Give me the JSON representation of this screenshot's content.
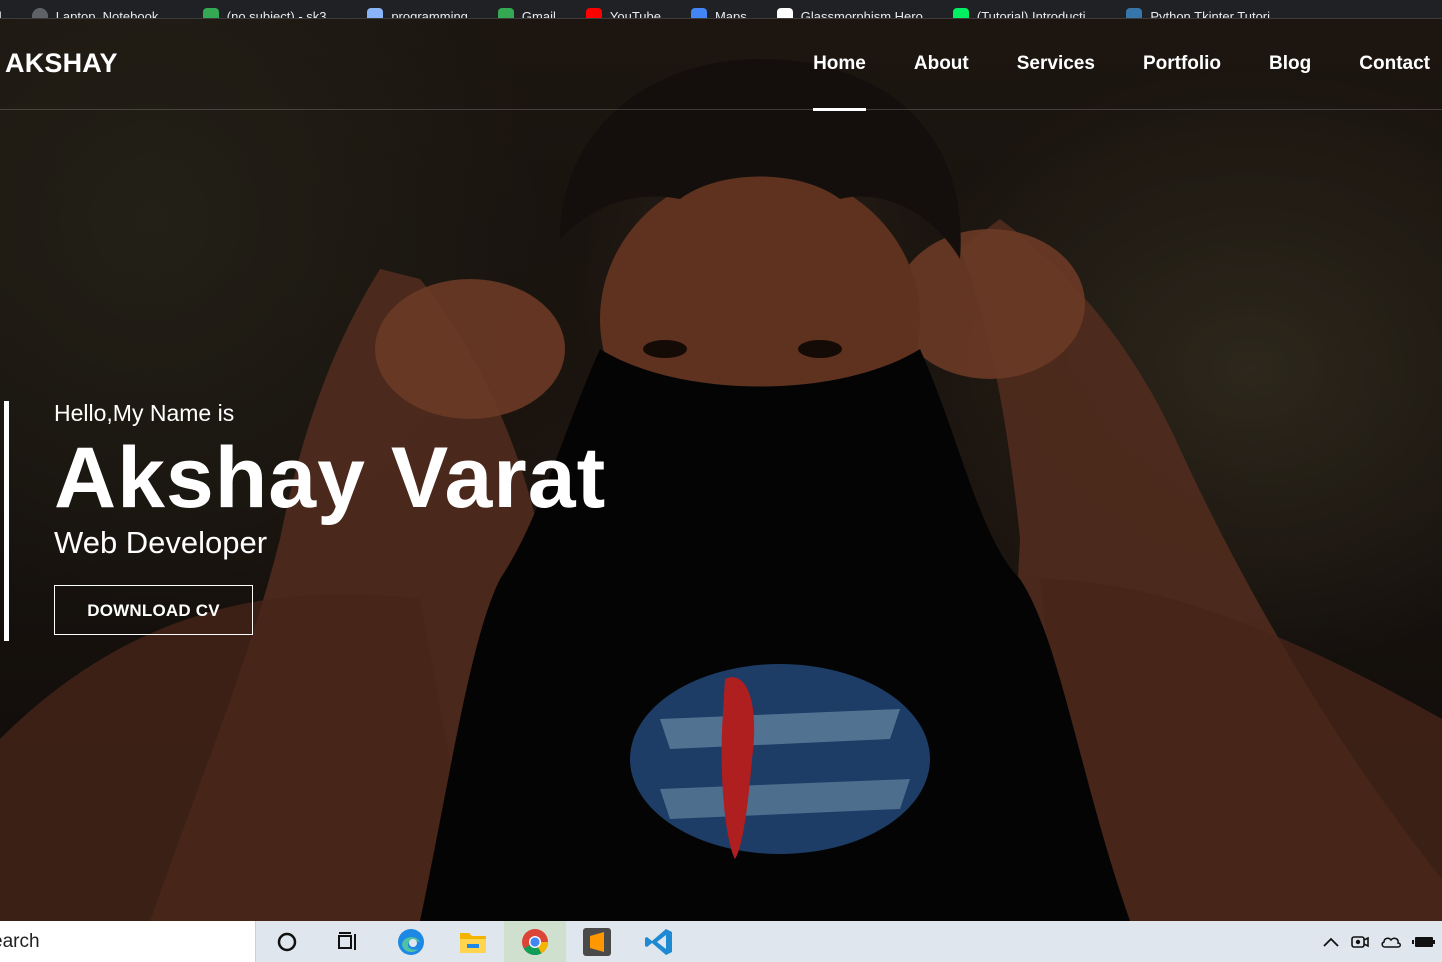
{
  "bookmarks": [
    {
      "label": "Laptop, Notebook,...",
      "icon": "globe-icon",
      "color": "#5f6368"
    },
    {
      "label": "(no subject) - sk3...",
      "icon": "gmail-icon",
      "color": "#34a853"
    },
    {
      "label": "programming",
      "icon": "folder-icon",
      "color": "#8ab4f8"
    },
    {
      "label": "Gmail",
      "icon": "gmail-icon",
      "color": "#34a853"
    },
    {
      "label": "YouTube",
      "icon": "youtube-icon",
      "color": "#ff0000"
    },
    {
      "label": "Maps",
      "icon": "maps-icon",
      "color": "#4285f4"
    },
    {
      "label": "Glassmorphism Hero",
      "icon": "github-icon",
      "color": "#ffffff"
    },
    {
      "label": "(Tutorial) Introducti...",
      "icon": "datacamp-icon",
      "color": "#03ef62"
    },
    {
      "label": "Python Tkinter Tutori...",
      "icon": "python-icon",
      "color": "#3776ab"
    }
  ],
  "nav": {
    "logo": "AKSHAY",
    "links": [
      "Home",
      "About",
      "Services",
      "Portfolio",
      "Blog",
      "Contact"
    ],
    "active": "Home"
  },
  "intro": {
    "greeting": "Hello,My Name is",
    "name": "Akshay Varat",
    "role": "Web Developer",
    "cta": "DOWNLOAD CV"
  },
  "taskbar": {
    "search_placeholder": "earch",
    "apps": [
      "cortana-icon",
      "task-view-icon",
      "edge-icon",
      "file-explorer-icon",
      "chrome-icon",
      "sublime-text-icon",
      "vscode-icon"
    ],
    "tray": [
      "chevron-up-icon",
      "meet-icon",
      "onedrive-icon",
      "battery-icon"
    ]
  },
  "colors": {
    "accent": "#ffffff",
    "taskbar": "#dfe6ee",
    "bookmarks_bar": "#202124"
  }
}
